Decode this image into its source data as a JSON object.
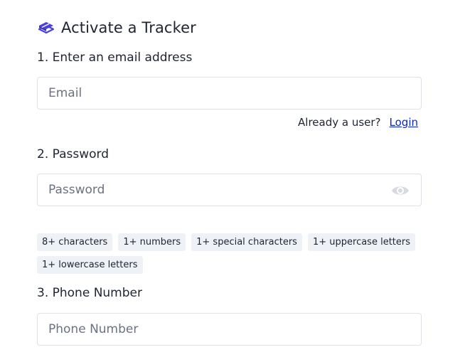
{
  "header": {
    "title": "Activate a Tracker",
    "logo_icon": "tracker-logo-icon"
  },
  "step1": {
    "label": "1. Enter an email address",
    "email_placeholder": "Email",
    "email_value": ""
  },
  "login_prompt": {
    "text": "Already a user?",
    "link": "Login"
  },
  "step2": {
    "label": "2. Password",
    "password_placeholder": "Password",
    "password_value": "",
    "toggle_icon": "eye-icon"
  },
  "requirements": [
    "8+ characters",
    "1+ numbers",
    "1+ special characters",
    "1+ uppercase letters",
    "1+ lowercase letters"
  ],
  "step3": {
    "label": "3. Phone Number",
    "phone_placeholder": "Phone Number",
    "phone_value": ""
  },
  "colors": {
    "brand": "#4a3fe0",
    "link": "#0b24d6",
    "chip_bg": "#eef2f7",
    "border": "#dfe2e7",
    "text": "#1f2433"
  }
}
